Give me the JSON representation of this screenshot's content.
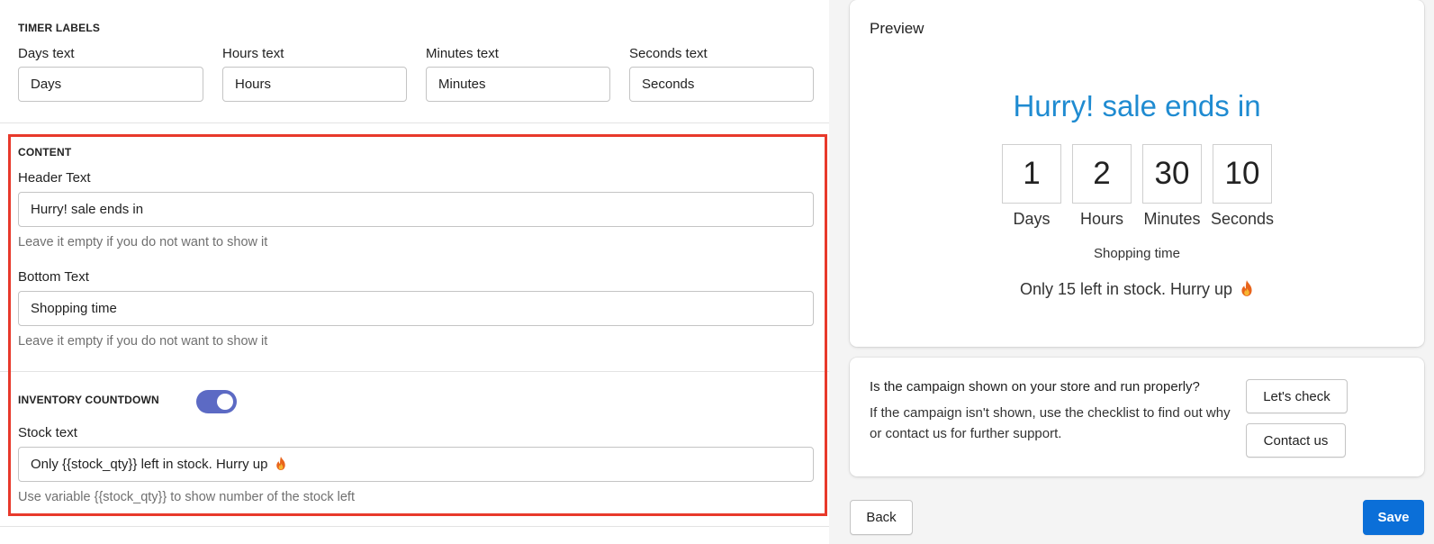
{
  "timer_labels": {
    "section_title": "TIMER LABELS",
    "days": {
      "label": "Days text",
      "value": "Days"
    },
    "hours": {
      "label": "Hours text",
      "value": "Hours"
    },
    "minutes": {
      "label": "Minutes text",
      "value": "Minutes"
    },
    "seconds": {
      "label": "Seconds text",
      "value": "Seconds"
    }
  },
  "content": {
    "section_title": "CONTENT",
    "header": {
      "label": "Header Text",
      "value": "Hurry! sale ends in",
      "help": "Leave it empty if you do not want to show it"
    },
    "bottom": {
      "label": "Bottom Text",
      "value": "Shopping time",
      "help": "Leave it empty if you do not want to show it"
    }
  },
  "inventory": {
    "section_title": "INVENTORY COUNTDOWN",
    "toggle_on": true,
    "stock": {
      "label": "Stock text",
      "value": "Only {{stock_qty}} left in stock. Hurry up",
      "help": "Use variable {{stock_qty}} to show number of the stock left"
    }
  },
  "preview": {
    "title": "Preview",
    "headline": "Hurry! sale ends in",
    "timer": [
      {
        "value": "1",
        "label": "Days"
      },
      {
        "value": "2",
        "label": "Hours"
      },
      {
        "value": "30",
        "label": "Minutes"
      },
      {
        "value": "10",
        "label": "Seconds"
      }
    ],
    "bottom_text": "Shopping time",
    "stock_text": "Only 15 left in stock. Hurry up"
  },
  "campaign_check": {
    "question": "Is the campaign shown on your store and run properly?",
    "description": "If the campaign isn't shown, use the checklist to find out why or contact us for further support.",
    "check_button": "Let's check",
    "contact_button": "Contact us"
  },
  "footer": {
    "back_label": "Back",
    "save_label": "Save"
  },
  "colors": {
    "accent": "#1f8bd1",
    "primary_button": "#0b6fd8",
    "toggle": "#5c6ac4",
    "highlight": "#e8392b"
  },
  "icons": {
    "stock_emoji": "fire-icon"
  }
}
